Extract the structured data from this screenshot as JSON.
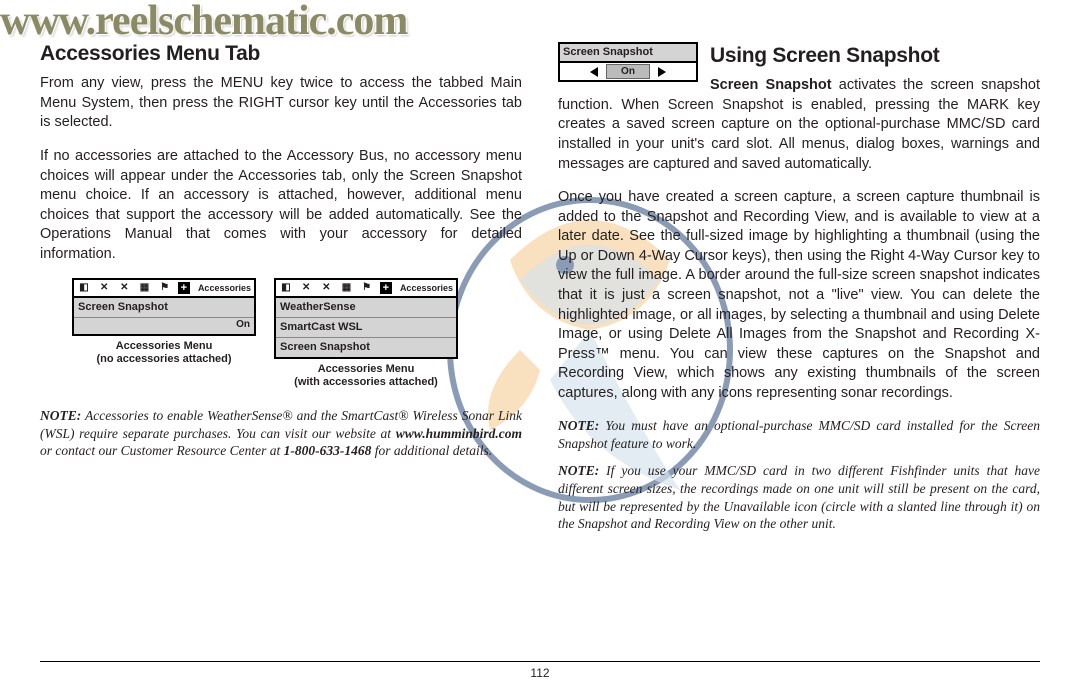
{
  "watermark_url": "www.reelschematic.com",
  "left": {
    "heading": "Accessories Menu Tab",
    "p1": "From any view, press the MENU key twice to access the tabbed Main Menu System, then press the RIGHT cursor key until the Accessories tab is selected.",
    "p2": "If no accessories are attached to the Accessory Bus, no accessory menu choices will appear under the Accessories tab, only the Screen Snapshot menu choice. If an accessory is attached, however, additional menu choices that support the accessory will be added automatically. See the Operations Manual that comes with your accessory for detailed information.",
    "fig1": {
      "tabs_label": "Accessories",
      "row1_label": "Screen Snapshot",
      "row1_value": "On",
      "caption_l1": "Accessories Menu",
      "caption_l2": "(no accessories attached)"
    },
    "fig2": {
      "tabs_label": "Accessories",
      "row1_label": "WeatherSense",
      "row2_label": "SmartCast WSL",
      "row3_label": "Screen Snapshot",
      "caption_l1": "Accessories Menu",
      "caption_l2": "(with accessories attached)"
    },
    "note_label": "NOTE:",
    "note_body": " Accessories to enable WeatherSense® and the SmartCast® Wireless Sonar Link (WSL) require separate purchases. You can visit our website at ",
    "note_url": "www.humminbird.com",
    "note_body2": " or contact our Customer Resource Center at ",
    "note_phone": "1-800-633-1468",
    "note_body3": " for additional details."
  },
  "right": {
    "heading": "Using Screen Snapshot",
    "snap_title": "Screen Snapshot",
    "snap_value": "On",
    "intro_bold": "Screen Snapshot",
    "intro_rest": " activates the screen snapshot function. When Screen Snapshot is enabled, pressing the MARK key creates a saved screen capture on the optional-purchase MMC/SD card installed in your unit's card slot. All menus, dialog boxes, warnings and messages are captured and saved automatically.",
    "p2": "Once you have created a screen capture, a screen capture thumbnail is added to the Snapshot and Recording View, and is available to view at a later date. See the full-sized image by highlighting a thumbnail (using the Up or Down 4-Way Cursor keys), then using the Right 4-Way Cursor key to view the full image. A border around the full-size screen snapshot indicates that it is just a screen snapshot, not a \"live\" view. You can delete the highlighted image, or all images, by selecting a thumbnail and using Delete Image, or using Delete All Images from the Snapshot and Recording X-Press™ menu. You can view these captures on the Snapshot and Recording View, which shows any existing thumbnails of the screen captures, along with any icons representing sonar recordings.",
    "note1_label": "NOTE:",
    "note1_body": " You must have an optional-purchase MMC/SD card installed for the Screen Snapshot feature to work.",
    "note2_label": "NOTE:",
    "note2_body": " If you use your MMC/SD card in two different Fishfinder units that have different screen sizes, the recordings made on one unit will still be present on the card, but will be represented by the Unavailable icon (circle with a slanted line through it) on the Snapshot and Recording View on the other unit."
  },
  "page_number": "112"
}
